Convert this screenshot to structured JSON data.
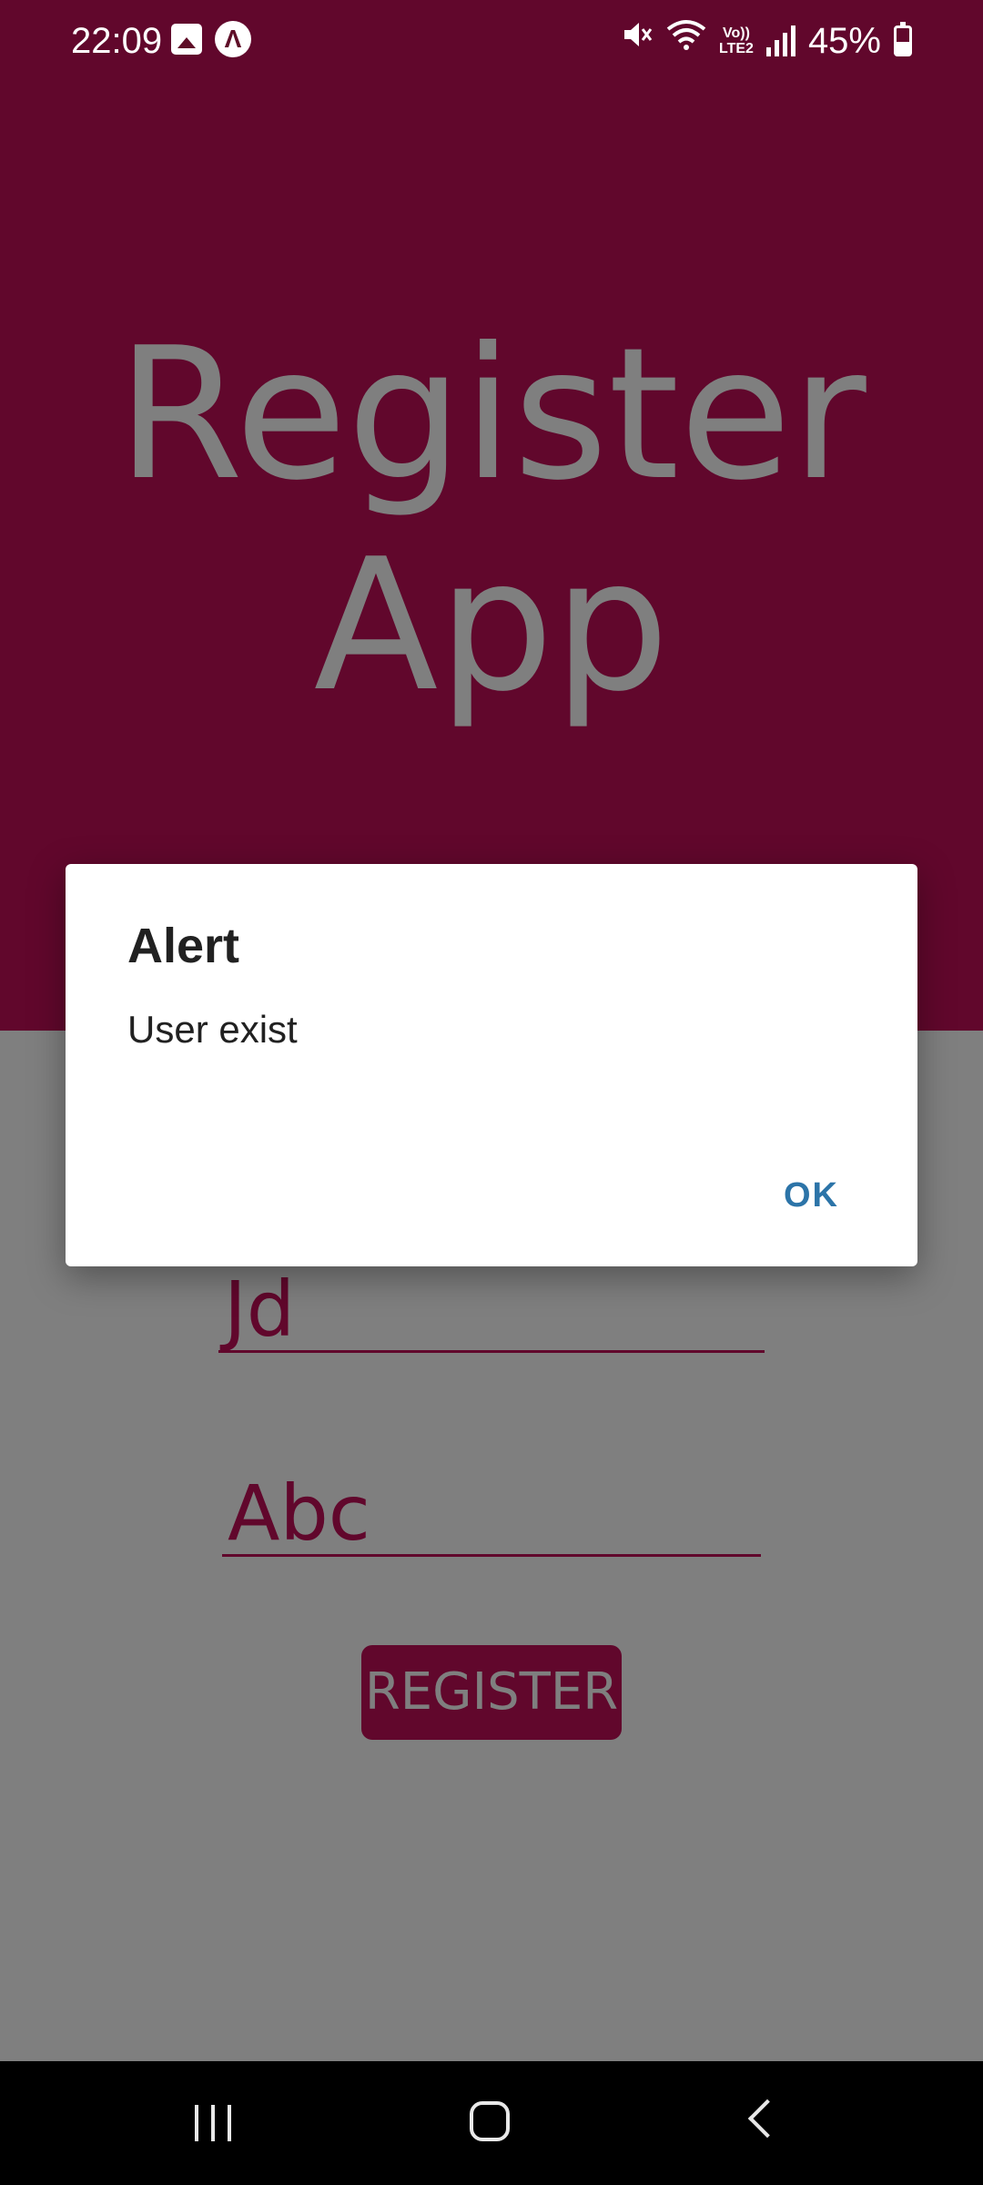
{
  "status_bar": {
    "time": "22:09",
    "battery": "45%",
    "lte_line1": "Vo))",
    "lte_line2": "LTE2",
    "nova_glyph": "Λ",
    "icons": [
      "gallery-icon",
      "nova-icon",
      "mute-icon",
      "wifi-icon",
      "volte-lte-icon",
      "signal-icon",
      "battery-icon"
    ]
  },
  "app": {
    "title_line1": "Register",
    "title_line2": "App",
    "name_value": "Jd",
    "password_value": "Abc",
    "register_label": "REGISTER",
    "brand_color": "#C30E59"
  },
  "dialog": {
    "title": "Alert",
    "message": "User exist",
    "ok_label": "OK",
    "accent_color": "#2C74A8"
  },
  "nav_bar": {
    "icons": [
      "recents-icon",
      "home-icon",
      "back-icon"
    ]
  }
}
